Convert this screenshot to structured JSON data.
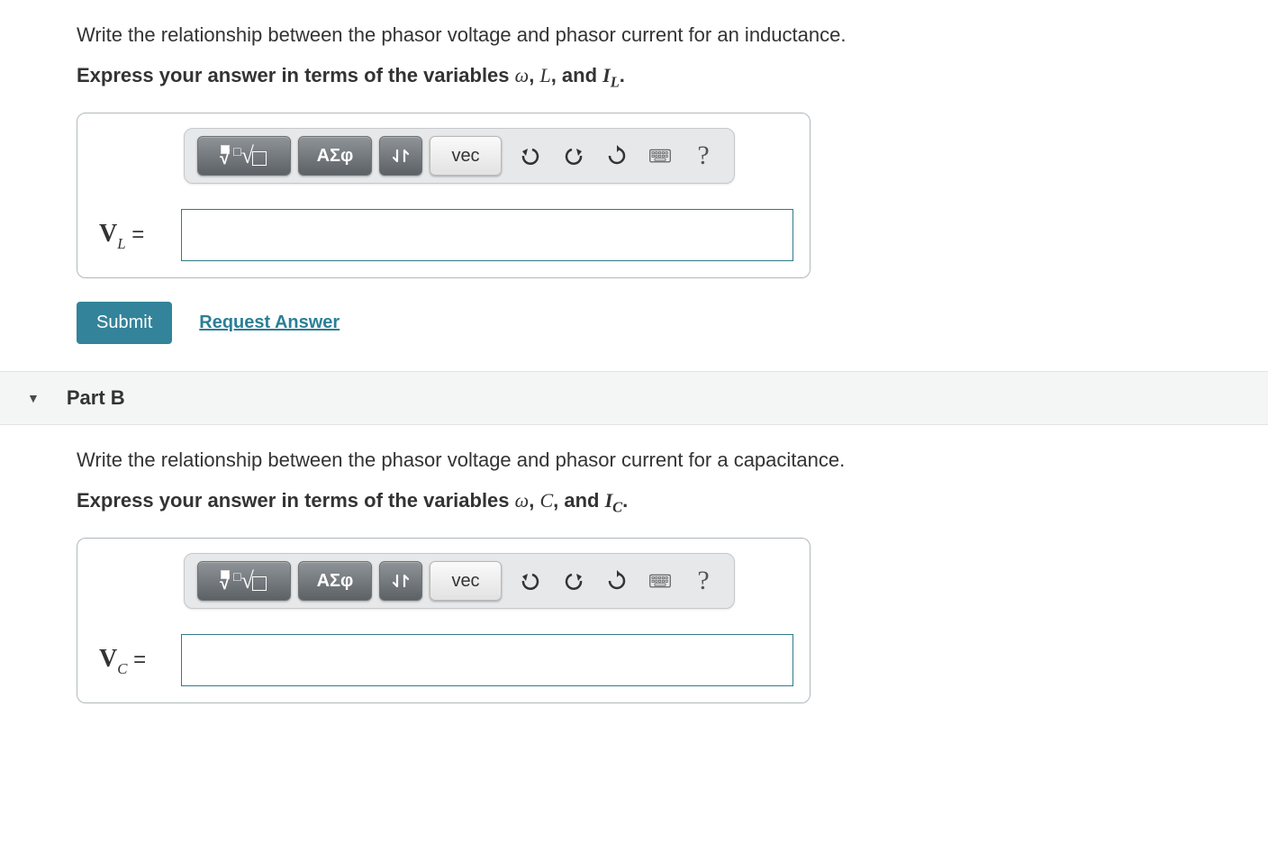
{
  "partA": {
    "instruction": "Write the relationship between the phasor voltage and phasor current for an inductance.",
    "express_prefix": "Express your answer in terms of the variables ",
    "var1": "ω",
    "sep1": ", ",
    "var2": "L",
    "sep2": ", and ",
    "var3_base": "I",
    "var3_sub": "L",
    "express_suffix": ".",
    "toolbar": {
      "greek_label": "ΑΣφ",
      "vec_label": "vec",
      "help_label": "?"
    },
    "label_base": "V",
    "label_sub": "L",
    "label_eq": " =",
    "input_value": "",
    "submit_label": "Submit",
    "request_label": "Request Answer"
  },
  "partB": {
    "header_label": "Part B",
    "instruction": "Write the relationship between the phasor voltage and phasor current for a capacitance.",
    "express_prefix": "Express your answer in terms of the variables ",
    "var1": "ω",
    "sep1": ", ",
    "var2": "C",
    "sep2": ", and ",
    "var3_base": "I",
    "var3_sub": "C",
    "express_suffix": ".",
    "toolbar": {
      "greek_label": "ΑΣφ",
      "vec_label": "vec",
      "help_label": "?"
    },
    "label_base": "V",
    "label_sub": "C",
    "label_eq": " =",
    "input_value": ""
  }
}
